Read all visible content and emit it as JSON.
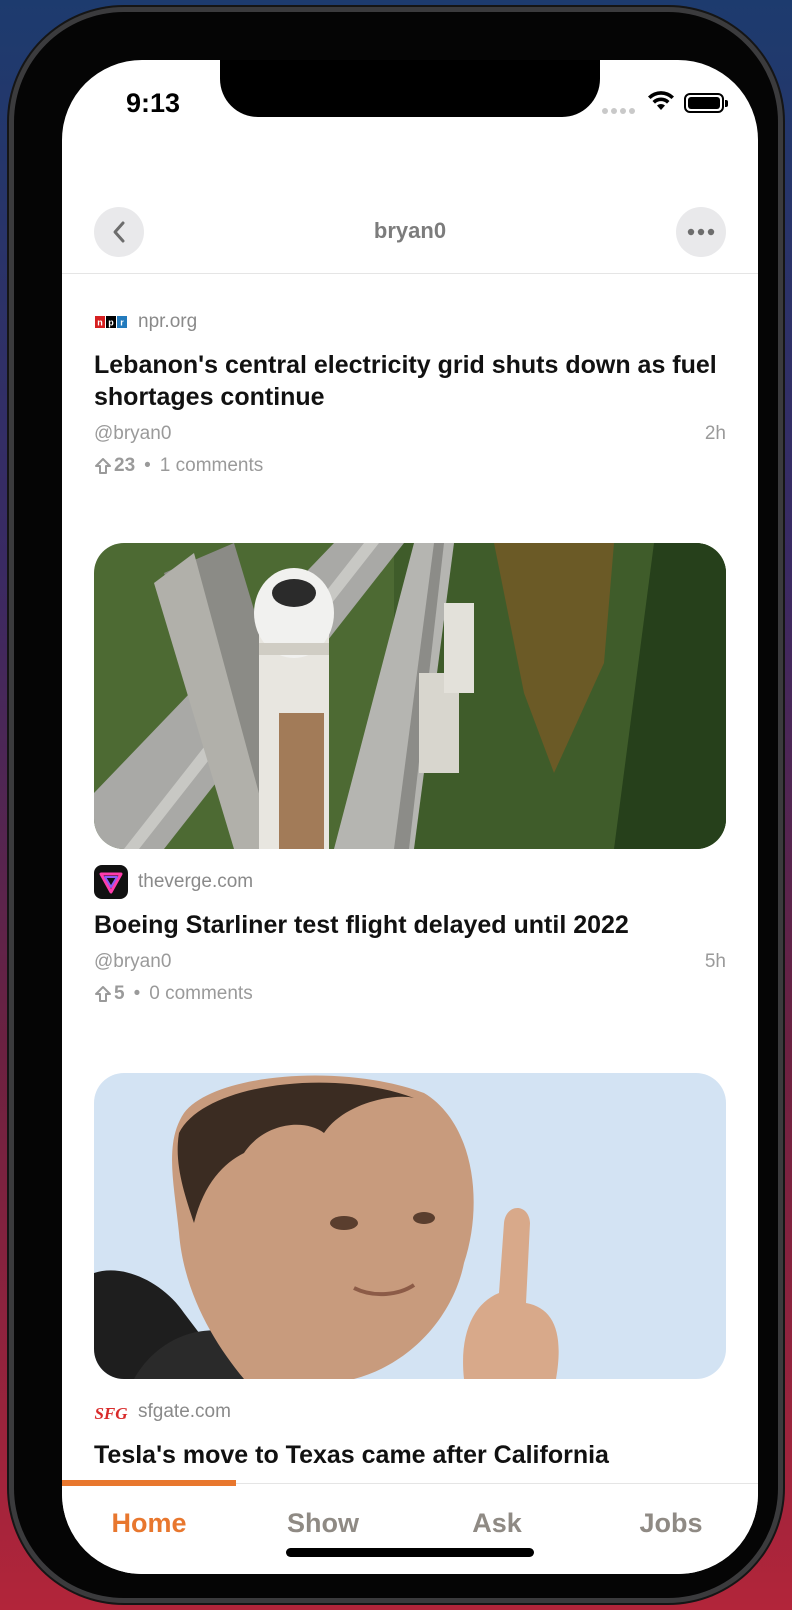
{
  "status_bar": {
    "time": "9:13"
  },
  "header": {
    "title": "bryan0"
  },
  "stories": [
    {
      "source_domain": "npr.org",
      "logo_text": "npr",
      "title": "Lebanon's central electricity grid shuts down as fuel shortages continue",
      "author": "@bryan0",
      "age": "2h",
      "points": "23",
      "comments": "1 comments"
    },
    {
      "source_domain": "theverge.com",
      "title": "Boeing Starliner test flight delayed until 2022",
      "author": "@bryan0",
      "age": "5h",
      "points": "5",
      "comments": "0 comments"
    },
    {
      "source_domain": "sfgate.com",
      "logo_text": "SFG",
      "title": "Tesla's move to Texas came after California"
    }
  ],
  "tabs": [
    {
      "label": "Home",
      "active": true
    },
    {
      "label": "Show",
      "active": false
    },
    {
      "label": "Ask",
      "active": false
    },
    {
      "label": "Jobs",
      "active": false
    }
  ],
  "colors": {
    "accent": "#e8772e",
    "tab_inactive": "#8f8a84",
    "meta_text": "#9a9a9a"
  },
  "icons": [
    "chevron-left-icon",
    "ellipsis-icon",
    "upvote-icon",
    "wifi-icon",
    "battery-icon",
    "cellular-icon"
  ]
}
